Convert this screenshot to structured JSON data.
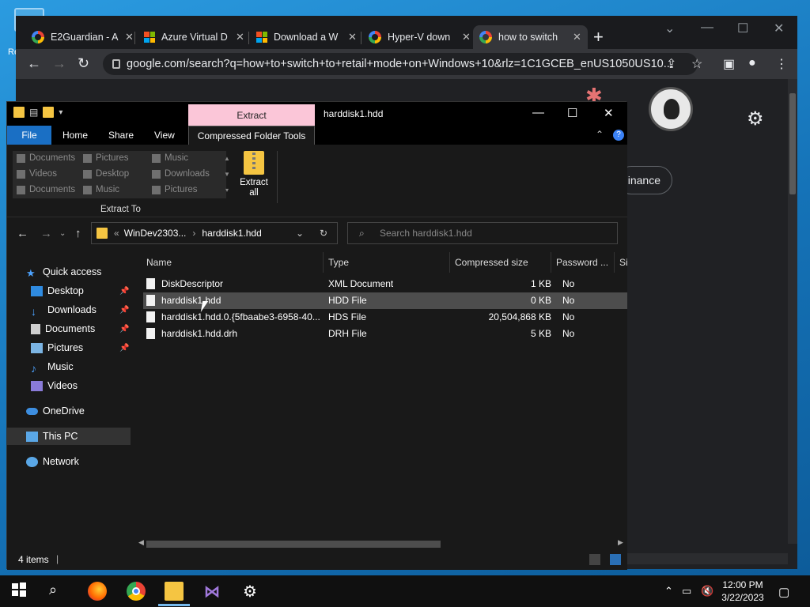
{
  "desktop": {
    "label": "Re"
  },
  "browser": {
    "tabs": [
      {
        "title": "E2Guardian - A",
        "icon": "google-icon"
      },
      {
        "title": "Azure Virtual D",
        "icon": "microsoft-icon"
      },
      {
        "title": "Download a W",
        "icon": "microsoft-icon"
      },
      {
        "title": "Hyper-V down",
        "icon": "google-icon"
      },
      {
        "title": "how to switch",
        "icon": "google-icon"
      }
    ],
    "url": "google.com/search?q=how+to+switch+to+retail+mode+on+Windows+10&rlz=1C1GCEB_enUS1050US10...",
    "chip": "inance"
  },
  "explorer": {
    "title": "harddisk1.hdd",
    "extract_tab": "Extract",
    "ribbon_tabs": [
      "File",
      "Home",
      "Share",
      "View",
      "Compressed Folder Tools"
    ],
    "gallery": [
      [
        "Documents",
        "Pictures",
        "Music"
      ],
      [
        "Videos",
        "Desktop",
        "Downloads"
      ],
      [
        "Documents",
        "Music",
        "Pictures"
      ]
    ],
    "extract_all": "Extract all",
    "group_label": "Extract To",
    "breadcrumb_prefix": "«",
    "breadcrumb": [
      "WinDev2303...",
      "harddisk1.hdd"
    ],
    "search_placeholder": "Search harddisk1.hdd",
    "nav": {
      "quick_access": "Quick access",
      "items": [
        "Desktop",
        "Downloads",
        "Documents",
        "Pictures",
        "Music",
        "Videos"
      ],
      "onedrive": "OneDrive",
      "thispc": "This PC",
      "network": "Network"
    },
    "columns": [
      "Name",
      "Type",
      "Compressed size",
      "Password ...",
      "Si"
    ],
    "files": [
      {
        "name": "DiskDescriptor",
        "type": "XML Document",
        "size": "1 KB",
        "password": "No"
      },
      {
        "name": "harddisk1.hdd",
        "type": "HDD File",
        "size": "0 KB",
        "password": "No"
      },
      {
        "name": "harddisk1.hdd.0.{5fbaabe3-6958-40...",
        "type": "HDS File",
        "size": "20,504,868 KB",
        "password": "No"
      },
      {
        "name": "harddisk1.hdd.drh",
        "type": "DRH File",
        "size": "5 KB",
        "password": "No"
      }
    ],
    "status": "4 items"
  },
  "taskbar": {
    "time": "12:00 PM",
    "date": "3/22/2023"
  }
}
